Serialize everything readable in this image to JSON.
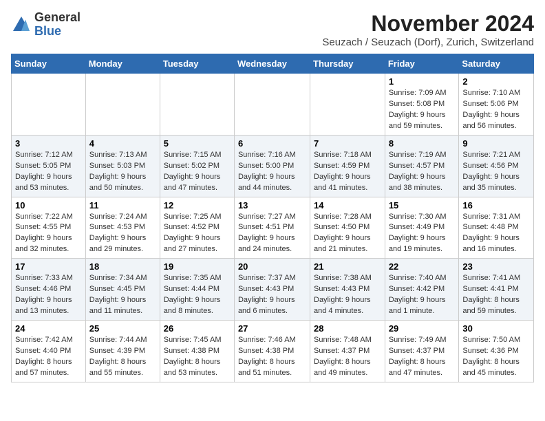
{
  "header": {
    "logo_general": "General",
    "logo_blue": "Blue",
    "month_title": "November 2024",
    "subtitle": "Seuzach / Seuzach (Dorf), Zurich, Switzerland"
  },
  "weekdays": [
    "Sunday",
    "Monday",
    "Tuesday",
    "Wednesday",
    "Thursday",
    "Friday",
    "Saturday"
  ],
  "weeks": [
    [
      {
        "day": "",
        "info": ""
      },
      {
        "day": "",
        "info": ""
      },
      {
        "day": "",
        "info": ""
      },
      {
        "day": "",
        "info": ""
      },
      {
        "day": "",
        "info": ""
      },
      {
        "day": "1",
        "info": "Sunrise: 7:09 AM\nSunset: 5:08 PM\nDaylight: 9 hours and 59 minutes."
      },
      {
        "day": "2",
        "info": "Sunrise: 7:10 AM\nSunset: 5:06 PM\nDaylight: 9 hours and 56 minutes."
      }
    ],
    [
      {
        "day": "3",
        "info": "Sunrise: 7:12 AM\nSunset: 5:05 PM\nDaylight: 9 hours and 53 minutes."
      },
      {
        "day": "4",
        "info": "Sunrise: 7:13 AM\nSunset: 5:03 PM\nDaylight: 9 hours and 50 minutes."
      },
      {
        "day": "5",
        "info": "Sunrise: 7:15 AM\nSunset: 5:02 PM\nDaylight: 9 hours and 47 minutes."
      },
      {
        "day": "6",
        "info": "Sunrise: 7:16 AM\nSunset: 5:00 PM\nDaylight: 9 hours and 44 minutes."
      },
      {
        "day": "7",
        "info": "Sunrise: 7:18 AM\nSunset: 4:59 PM\nDaylight: 9 hours and 41 minutes."
      },
      {
        "day": "8",
        "info": "Sunrise: 7:19 AM\nSunset: 4:57 PM\nDaylight: 9 hours and 38 minutes."
      },
      {
        "day": "9",
        "info": "Sunrise: 7:21 AM\nSunset: 4:56 PM\nDaylight: 9 hours and 35 minutes."
      }
    ],
    [
      {
        "day": "10",
        "info": "Sunrise: 7:22 AM\nSunset: 4:55 PM\nDaylight: 9 hours and 32 minutes."
      },
      {
        "day": "11",
        "info": "Sunrise: 7:24 AM\nSunset: 4:53 PM\nDaylight: 9 hours and 29 minutes."
      },
      {
        "day": "12",
        "info": "Sunrise: 7:25 AM\nSunset: 4:52 PM\nDaylight: 9 hours and 27 minutes."
      },
      {
        "day": "13",
        "info": "Sunrise: 7:27 AM\nSunset: 4:51 PM\nDaylight: 9 hours and 24 minutes."
      },
      {
        "day": "14",
        "info": "Sunrise: 7:28 AM\nSunset: 4:50 PM\nDaylight: 9 hours and 21 minutes."
      },
      {
        "day": "15",
        "info": "Sunrise: 7:30 AM\nSunset: 4:49 PM\nDaylight: 9 hours and 19 minutes."
      },
      {
        "day": "16",
        "info": "Sunrise: 7:31 AM\nSunset: 4:48 PM\nDaylight: 9 hours and 16 minutes."
      }
    ],
    [
      {
        "day": "17",
        "info": "Sunrise: 7:33 AM\nSunset: 4:46 PM\nDaylight: 9 hours and 13 minutes."
      },
      {
        "day": "18",
        "info": "Sunrise: 7:34 AM\nSunset: 4:45 PM\nDaylight: 9 hours and 11 minutes."
      },
      {
        "day": "19",
        "info": "Sunrise: 7:35 AM\nSunset: 4:44 PM\nDaylight: 9 hours and 8 minutes."
      },
      {
        "day": "20",
        "info": "Sunrise: 7:37 AM\nSunset: 4:43 PM\nDaylight: 9 hours and 6 minutes."
      },
      {
        "day": "21",
        "info": "Sunrise: 7:38 AM\nSunset: 4:43 PM\nDaylight: 9 hours and 4 minutes."
      },
      {
        "day": "22",
        "info": "Sunrise: 7:40 AM\nSunset: 4:42 PM\nDaylight: 9 hours and 1 minute."
      },
      {
        "day": "23",
        "info": "Sunrise: 7:41 AM\nSunset: 4:41 PM\nDaylight: 8 hours and 59 minutes."
      }
    ],
    [
      {
        "day": "24",
        "info": "Sunrise: 7:42 AM\nSunset: 4:40 PM\nDaylight: 8 hours and 57 minutes."
      },
      {
        "day": "25",
        "info": "Sunrise: 7:44 AM\nSunset: 4:39 PM\nDaylight: 8 hours and 55 minutes."
      },
      {
        "day": "26",
        "info": "Sunrise: 7:45 AM\nSunset: 4:38 PM\nDaylight: 8 hours and 53 minutes."
      },
      {
        "day": "27",
        "info": "Sunrise: 7:46 AM\nSunset: 4:38 PM\nDaylight: 8 hours and 51 minutes."
      },
      {
        "day": "28",
        "info": "Sunrise: 7:48 AM\nSunset: 4:37 PM\nDaylight: 8 hours and 49 minutes."
      },
      {
        "day": "29",
        "info": "Sunrise: 7:49 AM\nSunset: 4:37 PM\nDaylight: 8 hours and 47 minutes."
      },
      {
        "day": "30",
        "info": "Sunrise: 7:50 AM\nSunset: 4:36 PM\nDaylight: 8 hours and 45 minutes."
      }
    ]
  ]
}
